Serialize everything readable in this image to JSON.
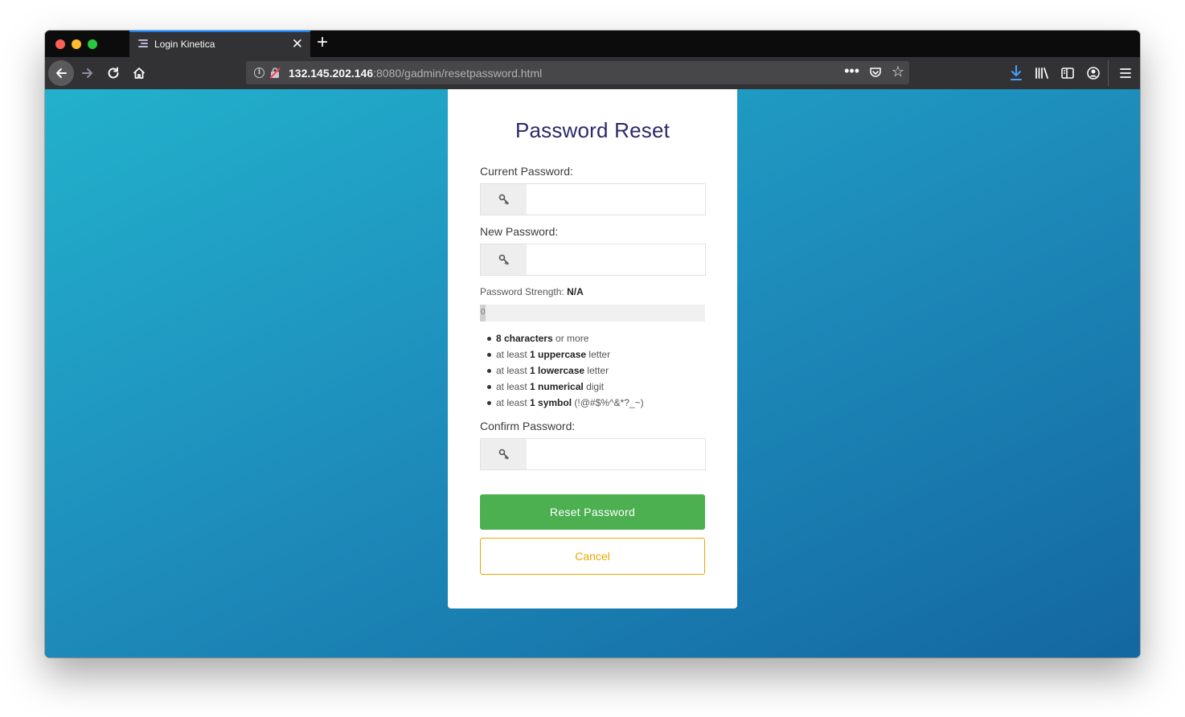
{
  "browser": {
    "tab_title": "Login Kinetica",
    "url_host": "132.145.202.146",
    "url_path": ":8080/gadmin/resetpassword.html",
    "accent_color": "#0a84ff"
  },
  "form": {
    "title": "Password Reset",
    "current_password_label": "Current Password:",
    "new_password_label": "New Password:",
    "strength_label": "Password Strength:",
    "strength_value": "N/A",
    "strength_progress": "0",
    "rules": [
      {
        "pre": "",
        "bold": "8 characters",
        "post": " or more"
      },
      {
        "pre": "at least ",
        "bold": "1 uppercase",
        "post": " letter"
      },
      {
        "pre": "at least ",
        "bold": "1 lowercase",
        "post": " letter"
      },
      {
        "pre": "at least ",
        "bold": "1 numerical",
        "post": " digit"
      },
      {
        "pre": "at least ",
        "bold": "1 symbol",
        "post": " (!@#$%^&*?_~)"
      }
    ],
    "confirm_password_label": "Confirm Password:",
    "reset_button": "Reset Password",
    "cancel_button": "Cancel",
    "reset_color": "#4caf50",
    "cancel_color": "#f0a500"
  }
}
